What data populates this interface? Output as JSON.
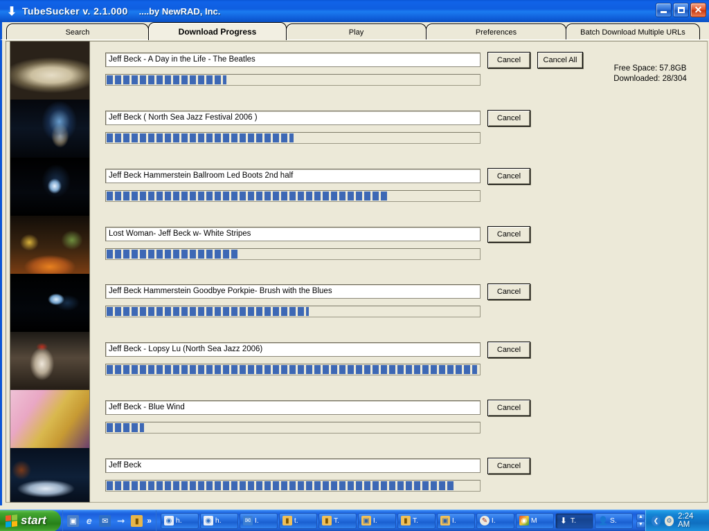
{
  "window": {
    "icon": "down-arrow-icon",
    "title": "TubeSucker  v. 2.1.000",
    "subtitle": "....by NewRAD, Inc.",
    "minimize_label": "Minimize",
    "maximize_label": "Maximize",
    "close_label": "Close"
  },
  "tabs": [
    {
      "label": "Search",
      "active": false
    },
    {
      "label": "Download Progress",
      "active": true
    },
    {
      "label": "Play",
      "active": false
    },
    {
      "label": "Preferences",
      "active": false
    },
    {
      "label": "Batch Download Multiple URLs",
      "active": false
    }
  ],
  "status": {
    "free_space": "Free Space: 57.8GB",
    "downloaded": "Downloaded: 28/304"
  },
  "buttons": {
    "cancel": "Cancel",
    "cancel_all": "Cancel All"
  },
  "downloads": [
    {
      "title": "Jeff Beck - A Day in the Life - The Beatles",
      "progress": 32,
      "cancel": "Cancel"
    },
    {
      "title": "Jeff Beck ( North Sea Jazz Festival 2006 )",
      "progress": 50,
      "cancel": "Cancel"
    },
    {
      "title": "Jeff Beck Hammerstein Ballroom   Led Boots 2nd half",
      "progress": 75,
      "cancel": "Cancel"
    },
    {
      "title": "Lost Woman- Jeff Beck w- White Stripes",
      "progress": 35,
      "cancel": "Cancel"
    },
    {
      "title": "Jeff Beck Hammerstein Goodbye Porkpie- Brush with the Blues",
      "progress": 54,
      "cancel": "Cancel"
    },
    {
      "title": "Jeff Beck - Lopsy Lu (North Sea Jazz 2006)",
      "progress": 99,
      "cancel": "Cancel"
    },
    {
      "title": "Jeff Beck - Blue Wind",
      "progress": 10,
      "cancel": "Cancel"
    },
    {
      "title": "Jeff Beck",
      "progress": 93,
      "cancel": "Cancel"
    }
  ],
  "thumbnails": [
    {
      "name": "thumb-guitar-closeup-1"
    },
    {
      "name": "thumb-stage-blue-light"
    },
    {
      "name": "thumb-dark-stage"
    },
    {
      "name": "thumb-band-orange-stage"
    },
    {
      "name": "thumb-dark-stage-2"
    },
    {
      "name": "thumb-performer-cap"
    },
    {
      "name": "thumb-guitar-pink"
    },
    {
      "name": "thumb-guitar-closeup-2"
    }
  ],
  "taskbar": {
    "start_label": "start",
    "quicklaunch": [
      {
        "name": "show-desktop-icon",
        "glyph": "⌗"
      },
      {
        "name": "internet-explorer-icon",
        "glyph": "e"
      },
      {
        "name": "outlook-express-icon",
        "glyph": "✉"
      },
      {
        "name": "pointer-icon",
        "glyph": "➡"
      },
      {
        "name": "folder-icon",
        "glyph": "■"
      }
    ],
    "quicklaunch_more": "»",
    "tasks": [
      {
        "label": "h.",
        "icon": "ie-document-icon",
        "active": false
      },
      {
        "label": "h.",
        "icon": "ie-document-icon",
        "active": false
      },
      {
        "label": "I.",
        "icon": "mail-icon",
        "active": false
      },
      {
        "label": "t.",
        "icon": "folder-icon",
        "active": false
      },
      {
        "label": "T.",
        "icon": "folder-icon",
        "active": false
      },
      {
        "label": "I.",
        "icon": "folder-image-icon",
        "active": false
      },
      {
        "label": "T.",
        "icon": "folder-icon",
        "active": false
      },
      {
        "label": "I.",
        "icon": "folder-image-icon",
        "active": false
      },
      {
        "label": "I.",
        "icon": "paint-icon",
        "active": false
      },
      {
        "label": "M",
        "icon": "media-icon",
        "active": false
      },
      {
        "label": "T.",
        "icon": "tubesucker-icon",
        "active": true
      },
      {
        "label": "S.",
        "icon": "person-icon",
        "active": false
      }
    ],
    "scroll_up": "▲",
    "scroll_down": "▼",
    "tray": [
      {
        "name": "show-hidden-icons-icon",
        "glyph": "❮"
      },
      {
        "name": "network-activity-icon",
        "glyph": "⚇"
      }
    ],
    "clock": "2:24 AM"
  },
  "colors": {
    "titlebar_blue": "#0a55d6",
    "progress_blue": "#3d68b5",
    "window_face": "#ece9d8",
    "start_green": "#2e8c22"
  }
}
